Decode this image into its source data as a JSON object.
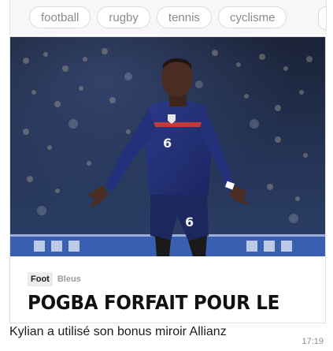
{
  "chips": [
    {
      "label": "football"
    },
    {
      "label": "rugby"
    },
    {
      "label": "tennis"
    },
    {
      "label": "cyclisme"
    }
  ],
  "card": {
    "tag": "Foot",
    "subtag": "Bleus",
    "headline": "POGBA FORFAIT POUR LE"
  },
  "message": {
    "text": "Kylian a utilisé son bonus miroir Allianz",
    "time": "17:19"
  }
}
